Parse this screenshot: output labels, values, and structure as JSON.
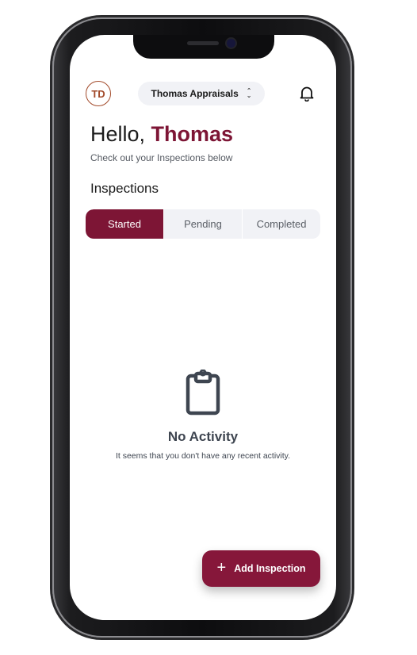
{
  "header": {
    "avatar_initials": "TD",
    "company_name": "Thomas Appraisals"
  },
  "greeting": {
    "hello": "Hello,",
    "name": "Thomas",
    "subtitle": "Check out your Inspections below"
  },
  "section_title": "Inspections",
  "tabs": [
    {
      "label": "Started",
      "active": true
    },
    {
      "label": "Pending",
      "active": false
    },
    {
      "label": "Completed",
      "active": false
    }
  ],
  "empty_state": {
    "icon": "clipboard-icon",
    "title": "No Activity",
    "description": "It seems that you don't have any recent activity."
  },
  "fab": {
    "icon": "plus-icon",
    "label": "Add Inspection"
  },
  "colors": {
    "brand": "#7d1535",
    "avatar_accent": "#a24a2a",
    "pill_background": "#f1f2f6",
    "empty_state_gray": "#3e4550"
  }
}
